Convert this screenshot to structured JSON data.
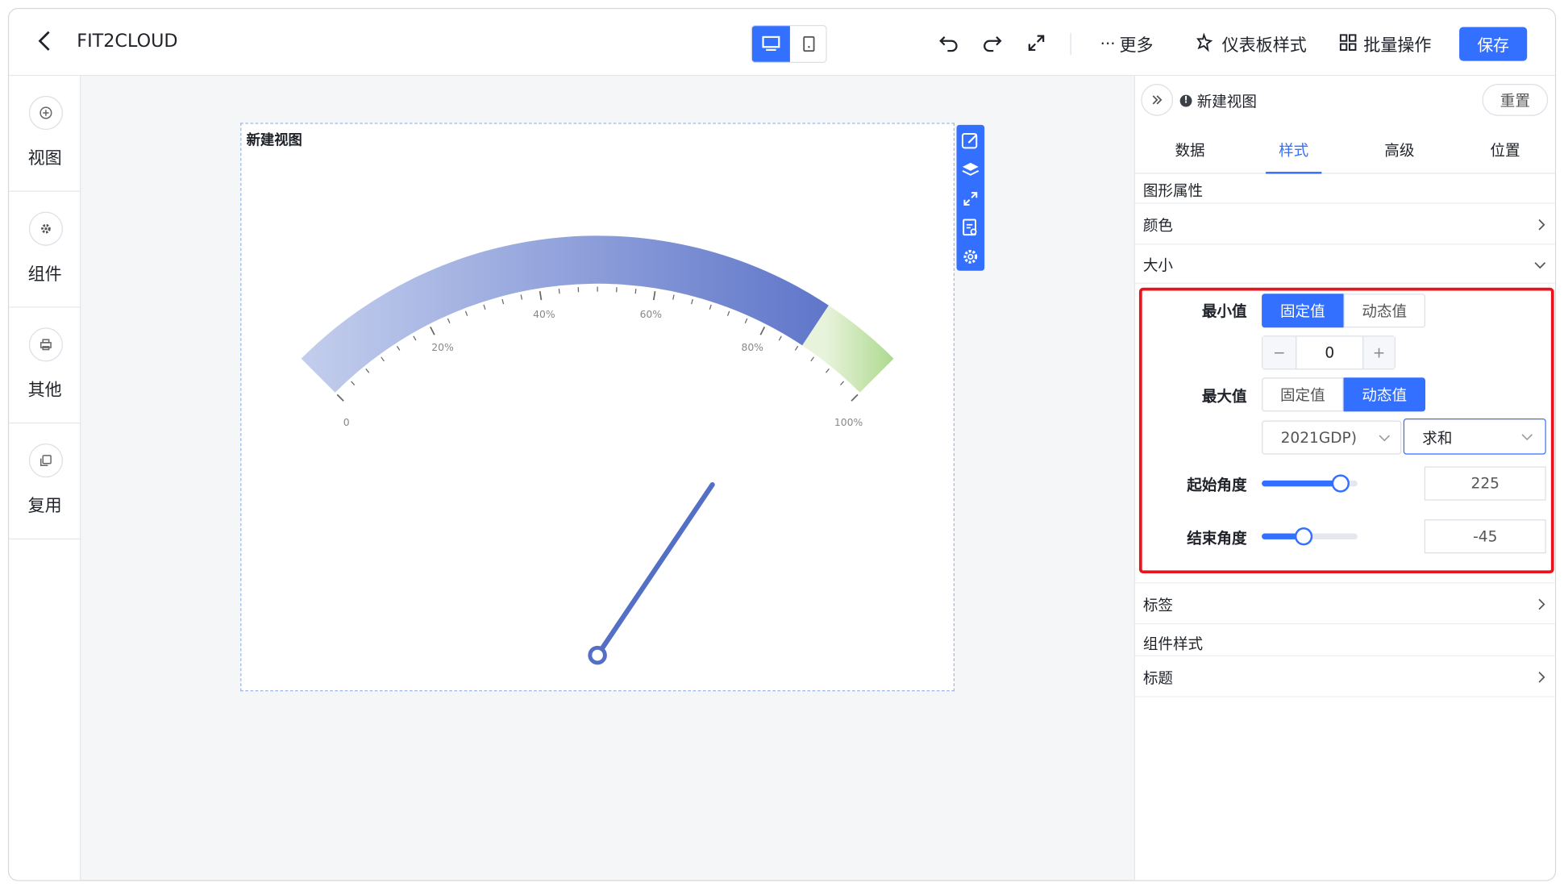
{
  "header": {
    "title": "FIT2CLOUD",
    "more_label": "更多",
    "dashboard_style_label": "仪表板样式",
    "batch_label": "批量操作",
    "save_label": "保存"
  },
  "sidebar": {
    "items": [
      {
        "label": "视图",
        "icon": "plus-circle-icon"
      },
      {
        "label": "组件",
        "icon": "gear-icon"
      },
      {
        "label": "其他",
        "icon": "printer-icon"
      },
      {
        "label": "复用",
        "icon": "copy-icon"
      }
    ]
  },
  "canvas": {
    "view_title": "新建视图",
    "gauge": {
      "min": 0,
      "max": 100,
      "tick_labels": [
        "0",
        "20%",
        "40%",
        "60%",
        "80%",
        "100%"
      ],
      "colors": [
        "#c6d0ee",
        "#5b72c8",
        "#e6f2d8",
        "#95cf6e"
      ],
      "pointer_color": "#5470c6",
      "pointer_value_fraction": 0.7
    }
  },
  "panel": {
    "view_name": "新建视图",
    "reset_label": "重置",
    "tabs": [
      "数据",
      "样式",
      "高级",
      "位置"
    ],
    "active_tab": "样式",
    "graph_props_label": "图形属性",
    "color_label": "颜色",
    "size_label": "大小",
    "min_label": "最小值",
    "max_label": "最大值",
    "fixed_label": "固定值",
    "dynamic_label": "动态值",
    "min_value": "0",
    "field_select": "2021GDP)",
    "agg_select": "求和",
    "start_angle_label": "起始角度",
    "start_angle_value": "225",
    "start_angle_fraction": 0.82,
    "end_angle_label": "结束角度",
    "end_angle_value": "-45",
    "end_angle_fraction": 0.44,
    "label_section": "标签",
    "component_style_label": "组件样式",
    "title_section": "标题",
    "accent": "#3370ff",
    "highlight": "#e8141b"
  }
}
